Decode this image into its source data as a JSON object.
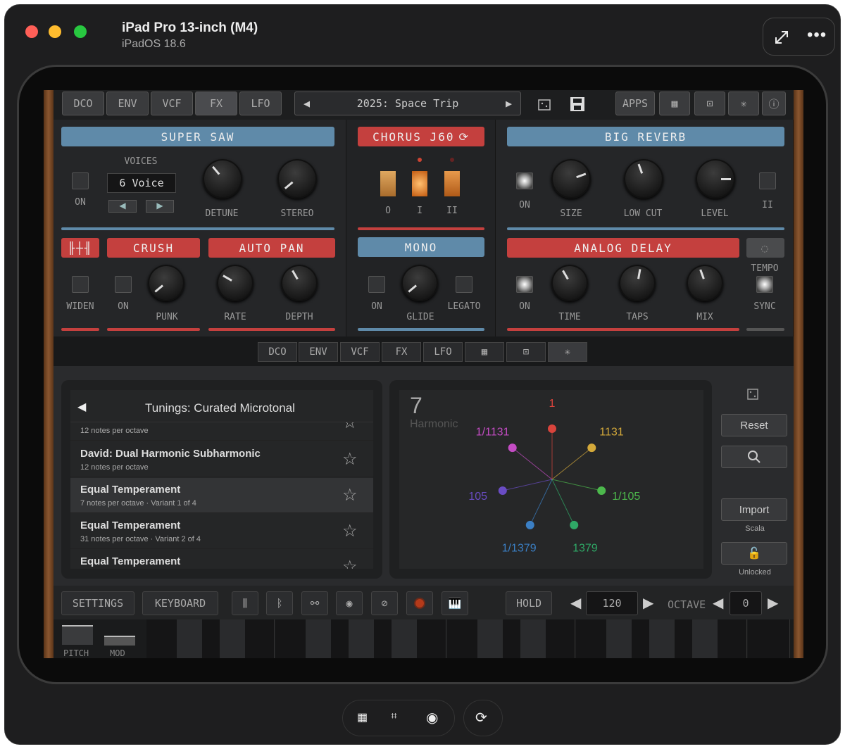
{
  "window": {
    "title": "iPad Pro 13-inch (M4)",
    "subtitle": "iPadOS 18.6",
    "icons": [
      "expand-icon",
      "more-icon"
    ]
  },
  "top_tabs": [
    "DCO",
    "ENV",
    "VCF",
    "FX",
    "LFO"
  ],
  "preset": {
    "name": "2025: Space Trip",
    "prev": "◀",
    "next": "▶"
  },
  "top_right": {
    "apps": "APPS"
  },
  "super_saw": {
    "title": "SUPER SAW",
    "voices_label": "VOICES",
    "voices_value": "6 Voice",
    "on": "ON",
    "detune": "DETUNE",
    "stereo": "STEREO"
  },
  "chorus": {
    "title": "CHORUS J60",
    "labels": [
      "O",
      "I",
      "II"
    ]
  },
  "reverb": {
    "title": "BIG REVERB",
    "on": "ON",
    "size": "SIZE",
    "low_cut": "LOW CUT",
    "level": "LEVEL",
    "ii": "II"
  },
  "crush": {
    "title": "CRUSH",
    "on": "ON",
    "punk": "PUNK",
    "widen": "WIDEN"
  },
  "auto_pan": {
    "title": "AUTO PAN",
    "rate": "RATE",
    "depth": "DEPTH"
  },
  "mono": {
    "title": "MONO",
    "on": "ON",
    "glide": "GLIDE",
    "legato": "LEGATO"
  },
  "delay": {
    "title": "ANALOG DELAY",
    "on": "ON",
    "time": "TIME",
    "taps": "TAPS",
    "mix": "MIX",
    "tempo": "TEMPO",
    "sync": "SYNC"
  },
  "lower_tabs": [
    "DCO",
    "ENV",
    "VCF",
    "FX",
    "LFO"
  ],
  "tunings": {
    "title": "Tunings: Curated Microtonal",
    "back": "◀",
    "rows": [
      {
        "title": "",
        "sub": "12 notes per octave"
      },
      {
        "title": "David: Dual Harmonic Subharmonic",
        "sub": "12 notes per octave"
      },
      {
        "title": "Equal Temperament",
        "sub": "7 notes per octave · Variant 1 of 4"
      },
      {
        "title": "Equal Temperament",
        "sub": "31 notes per octave · Variant 2 of 4"
      },
      {
        "title": "Equal Temperament",
        "sub": ""
      }
    ]
  },
  "harmonic": {
    "count": "7",
    "label": "Harmonic",
    "nodes": [
      "1",
      "1131",
      "1/105",
      "1379",
      "1/1379",
      "105",
      "1/1131"
    ],
    "colors": [
      "#d9443c",
      "#d4a93a",
      "#4cb84c",
      "#2fa866",
      "#3b7fc4",
      "#6a4cc4",
      "#c44cc4"
    ]
  },
  "right_buttons": {
    "reset": "Reset",
    "import": "Import",
    "scala": "Scala",
    "unlocked": "Unlocked"
  },
  "bottom": {
    "settings": "SETTINGS",
    "keyboard": "KEYBOARD",
    "hold": "HOLD",
    "tempo": "120",
    "octave_label": "OCTAVE",
    "octave": "0",
    "pitch": "PITCH",
    "mod": "MOD"
  }
}
